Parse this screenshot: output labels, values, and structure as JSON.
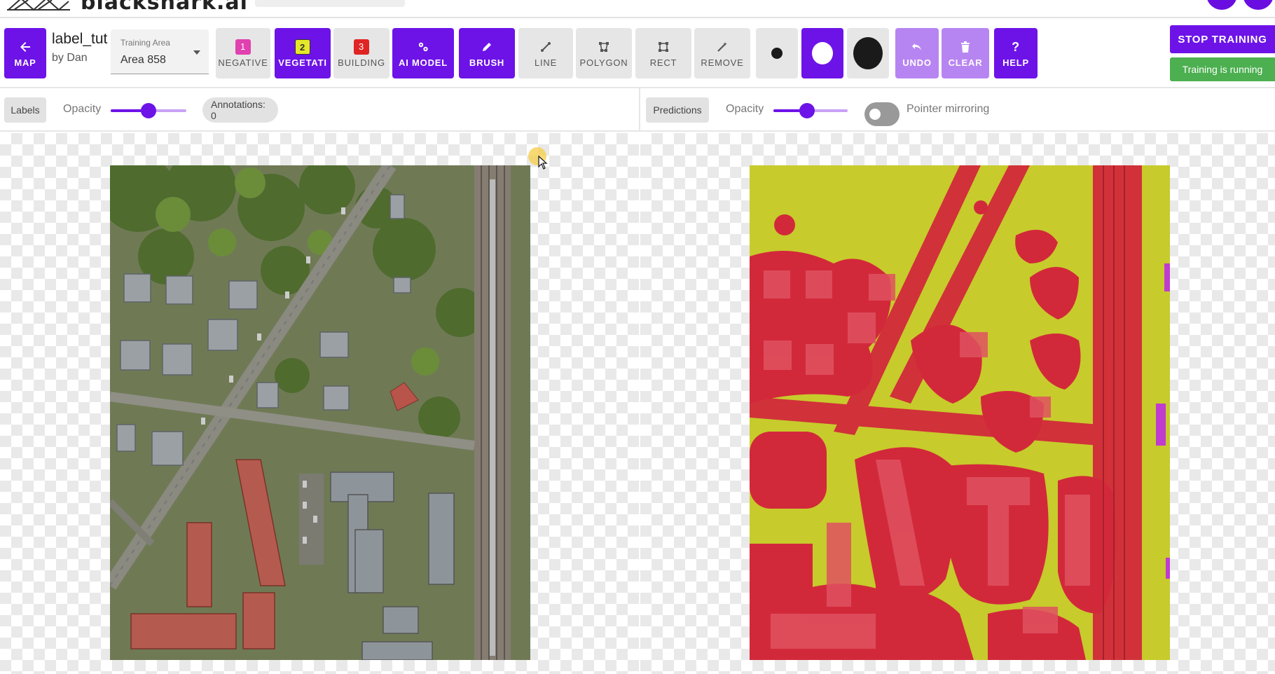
{
  "header": {
    "logo_text": "blackshark.ai"
  },
  "toolbar": {
    "map_button": {
      "label": "MAP",
      "icon": "arrow-left-icon"
    },
    "project": {
      "name": "label_tut",
      "owner": "by Dan"
    },
    "training_area": {
      "label": "Training Area",
      "value": "Area 858"
    },
    "classes": [
      {
        "number": "1",
        "label": "NEGATIVE",
        "color": "#e040b0",
        "selected": false
      },
      {
        "number": "2",
        "label": "VEGETATI",
        "color": "#e6e62a",
        "selected": true
      },
      {
        "number": "3",
        "label": "BUILDING",
        "color": "#e02424",
        "selected": false
      }
    ],
    "ai_model": {
      "label": "AI MODEL",
      "icon": "ai-model-icon"
    },
    "tools": {
      "brush": {
        "label": "BRUSH",
        "icon": "brush-icon"
      },
      "line": {
        "label": "LINE",
        "icon": "line-icon"
      },
      "polygon": {
        "label": "POLYGON",
        "icon": "polygon-icon"
      },
      "rect": {
        "label": "RECT",
        "icon": "rect-icon"
      },
      "remove": {
        "label": "REMOVE",
        "icon": "wand-icon"
      }
    },
    "brush_sizes": [
      "small",
      "medium",
      "large"
    ],
    "selected_brush_size": "medium",
    "undo": {
      "label": "UNDO",
      "icon": "undo-icon"
    },
    "clear": {
      "label": "CLEAR",
      "icon": "trash-icon"
    },
    "help": {
      "label": "HELP",
      "icon": "?"
    },
    "stop_training": "STOP TRAINING",
    "status": "Training is running"
  },
  "left_controls": {
    "labels_chip": "Labels",
    "opacity_label": "Opacity",
    "opacity": 0.5,
    "annotations": "Annotations: 0"
  },
  "right_controls": {
    "predictions_chip": "Predictions",
    "opacity_label": "Opacity",
    "opacity": 0.45,
    "pointer_mirroring_label": "Pointer mirroring",
    "pointer_mirroring": false
  },
  "colors": {
    "accent": "#6d13e8",
    "accent_light": "#b785f2",
    "status_green": "#4caf50",
    "prediction_vegetation": "#c8cc2a",
    "prediction_building": "#d42a38"
  }
}
